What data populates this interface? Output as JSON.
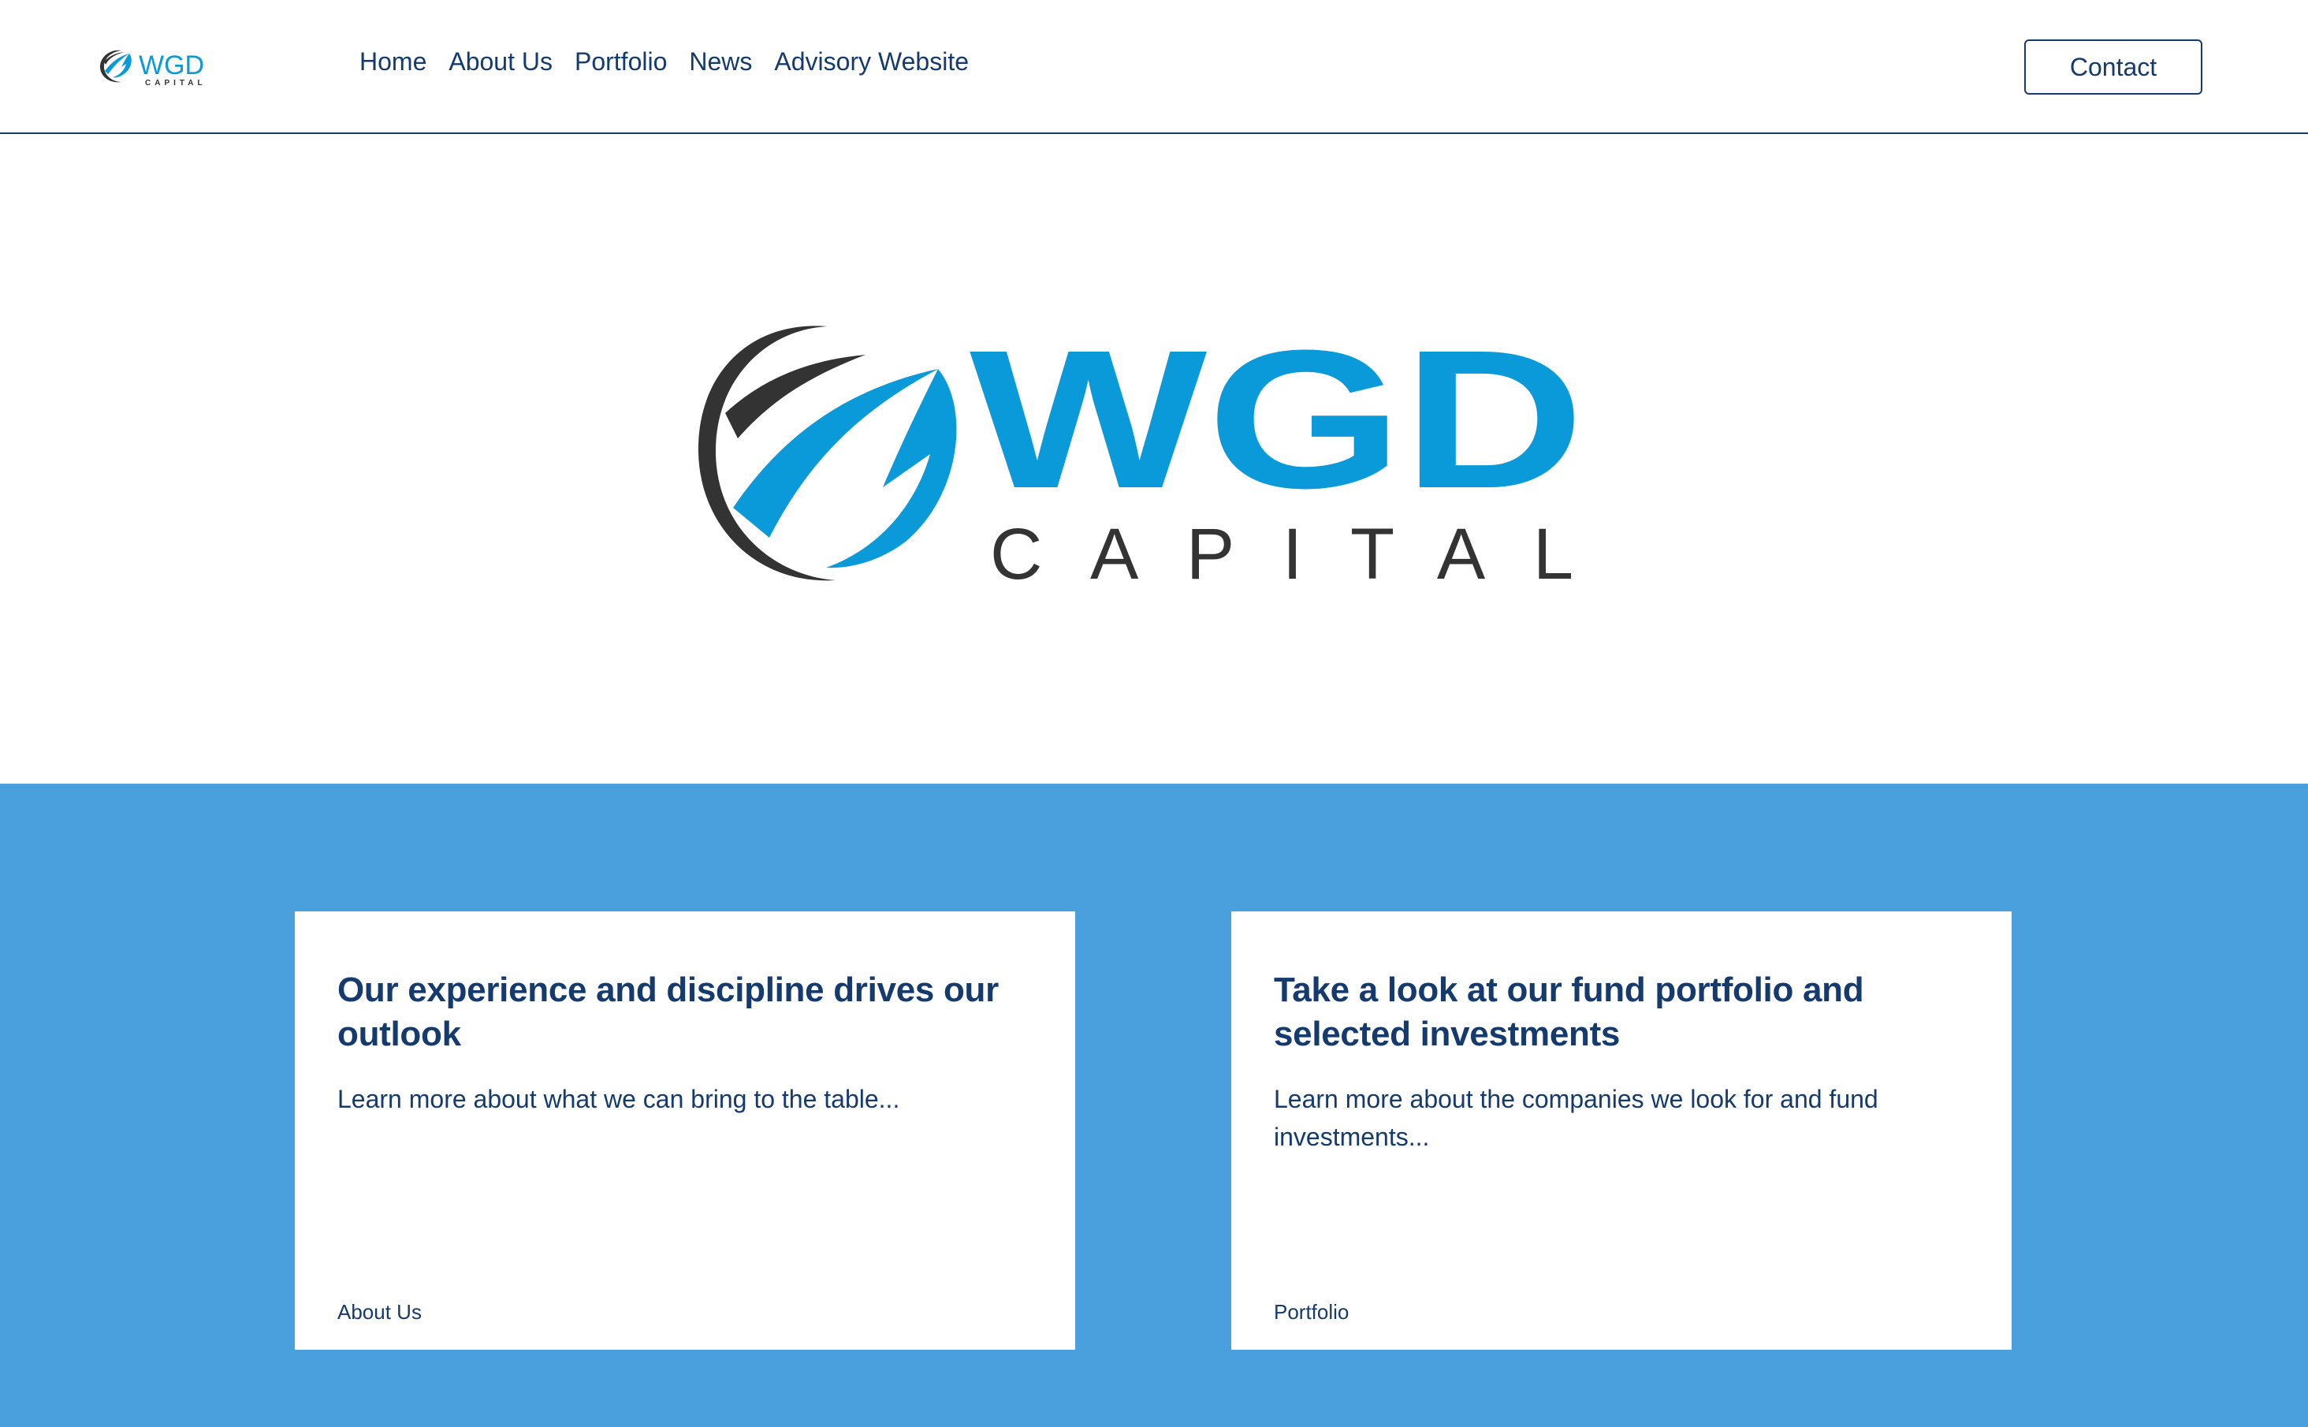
{
  "header": {
    "logo_text": "WGD",
    "logo_subtext": "CAPITAL",
    "nav": [
      {
        "label": "Home",
        "active": true
      },
      {
        "label": "About Us",
        "active": false
      },
      {
        "label": "Portfolio",
        "active": false
      },
      {
        "label": "News",
        "active": false
      },
      {
        "label": "Advisory Website",
        "active": false
      }
    ],
    "contact_label": "Contact"
  },
  "hero": {
    "logo_text": "WGD",
    "logo_subtext": "CAPITAL",
    "logo_icon": "swoosh-globe-icon"
  },
  "cards": [
    {
      "title": "Our experience and discipline drives our outlook",
      "description": "Learn more about what we can bring to the table...",
      "link_label": "About Us"
    },
    {
      "title": "Take a look at our fund portfolio and selected investments",
      "description": "Learn more about the companies we look for and fund investments...",
      "link_label": "Portfolio"
    }
  ],
  "colors": {
    "brand_blue": "#0b9ad9",
    "brand_dark": "#333333",
    "navy": "#153a6e",
    "section_blue": "#4aa0dd"
  }
}
